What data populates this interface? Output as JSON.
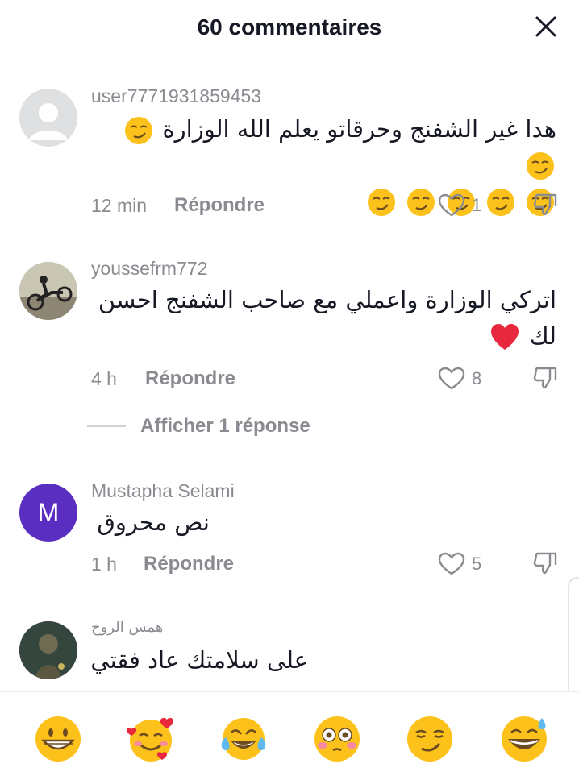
{
  "header": {
    "title": "60 commentaires"
  },
  "comments": [
    {
      "username": "user7771931859453",
      "text": "هدا غير الشفنج وحرقاتو يعلم الله الوزارة",
      "time": "12 min",
      "reply_label": "Répondre",
      "likes": "1",
      "avatar": "default-avatar-icon"
    },
    {
      "username": "youssefrm772",
      "text_line1": "اتركي الوزارة واعملي مع صاحب الشفنج احسن",
      "text_line2": "لك",
      "time": "4 h",
      "reply_label": "Répondre",
      "likes": "8",
      "avatar": "motorcycle-photo"
    },
    {
      "username": "Mustapha Selami",
      "avatar_letter": "M",
      "avatar_color": "#5b2ec2",
      "text": "نص محروق",
      "time": "1 h",
      "reply_label": "Répondre",
      "likes": "5"
    },
    {
      "username": "همس الروح",
      "text": "على سلامتك عاد فقتي",
      "avatar": "dark-photo"
    }
  ],
  "view_replies": "Afficher 1 réponse",
  "emoji_bar": [
    "grinning-face",
    "smiling-face-with-hearts",
    "tears-of-joy",
    "flushed-face",
    "smirking-face",
    "grinning-sweat-face"
  ],
  "colors": {
    "text_primary": "#161823",
    "text_secondary": "#8a8b91",
    "heart_red": "#e8283c"
  }
}
